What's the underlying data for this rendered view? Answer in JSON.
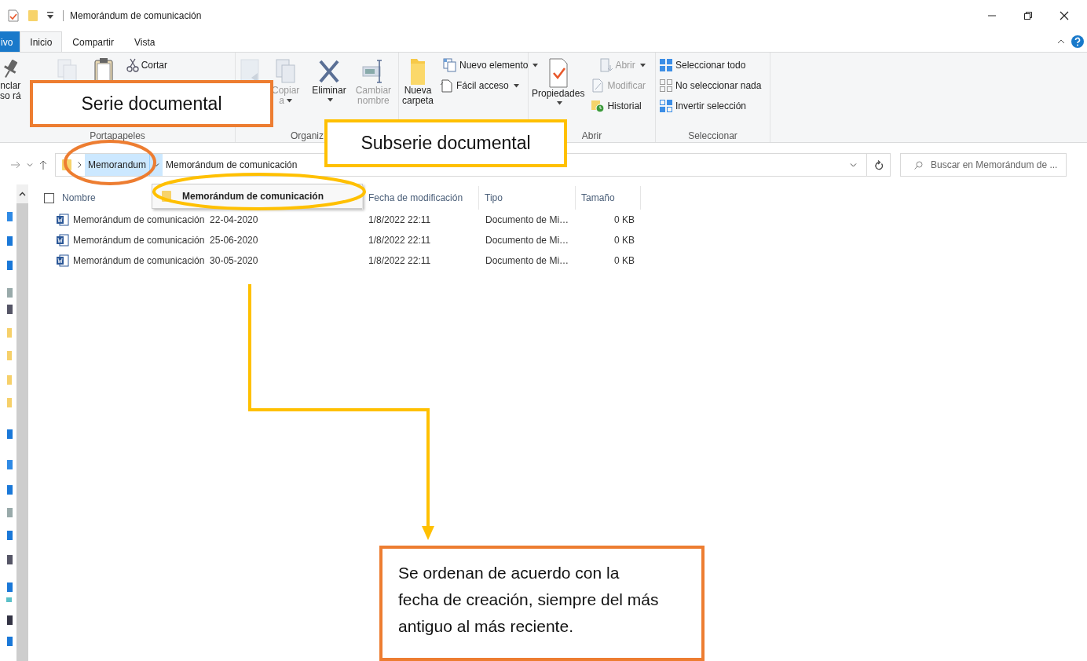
{
  "window": {
    "title": "Memorándum de comunicación"
  },
  "ribbon_tabs": [
    {
      "label": "ivo",
      "kind": "file",
      "selected": false
    },
    {
      "label": "Inicio",
      "kind": "tab",
      "selected": true
    },
    {
      "label": "Compartir",
      "kind": "tab",
      "selected": false
    },
    {
      "label": "Vista",
      "kind": "tab",
      "selected": false
    }
  ],
  "ribbon_groups": [
    {
      "label": "Portapapeles",
      "commands": [
        {
          "kind": "large",
          "lines": [
            "nclar",
            "so rá"
          ],
          "dropdown": false,
          "disabled": false
        },
        {
          "kind": "icon",
          "disabled": true
        },
        {
          "kind": "icon",
          "disabled": false
        },
        {
          "kind": "small",
          "label": "Cortar",
          "dropdown": false,
          "disabled": false
        }
      ]
    },
    {
      "label": "Organiz",
      "commands": [
        {
          "kind": "icon",
          "disabled": true
        },
        {
          "kind": "large",
          "lines": [
            "Copiar",
            "a"
          ],
          "dropdown": true,
          "disabled": true
        },
        {
          "kind": "large",
          "lines": [
            "Eliminar"
          ],
          "dropdown": true,
          "disabled": false
        },
        {
          "kind": "large",
          "lines": [
            "Cambiar",
            "nombre"
          ],
          "dropdown": false,
          "disabled": true
        }
      ]
    },
    {
      "commands": [
        {
          "kind": "large",
          "lines": [
            "Nueva",
            "carpeta"
          ],
          "dropdown": false,
          "disabled": false
        },
        {
          "kind": "small",
          "label": "Nuevo elemento",
          "dropdown": true,
          "disabled": false
        },
        {
          "kind": "small",
          "label": "Fácil acceso",
          "dropdown": true,
          "disabled": false
        }
      ]
    },
    {
      "label": "Abrir",
      "commands": [
        {
          "kind": "large",
          "lines": [
            "Propiedades"
          ],
          "dropdown": true,
          "disabled": false
        },
        {
          "kind": "small",
          "label": "Abrir",
          "dropdown": true,
          "disabled": true
        },
        {
          "kind": "small",
          "label": "Modificar",
          "dropdown": false,
          "disabled": true
        },
        {
          "kind": "small",
          "label": "Historial",
          "dropdown": false,
          "disabled": false
        }
      ]
    },
    {
      "label": "Seleccionar",
      "commands": [
        {
          "kind": "small",
          "label": "Seleccionar todo",
          "dropdown": false,
          "disabled": false
        },
        {
          "kind": "small",
          "label": "No seleccionar nada",
          "dropdown": false,
          "disabled": false
        },
        {
          "kind": "small",
          "label": "Invertir selección",
          "dropdown": false,
          "disabled": false
        }
      ]
    }
  ],
  "address": {
    "breadcrumbs": [
      {
        "label": "Memorandum",
        "selected": true
      },
      {
        "label": "Memorándum de comunicación",
        "selected": false
      }
    ],
    "menu": [
      {
        "label": "Memorándum de comunicación"
      }
    ],
    "search": {
      "placeholder": "Buscar en Memorándum de ..."
    }
  },
  "file_list": {
    "checked": false,
    "columns": [
      "Nombre",
      "Fecha de modificación",
      "Tipo",
      "Tamaño"
    ],
    "rows": [
      {
        "name": "Memorándum de comunicación  22-04-2020",
        "modified": "1/8/2022 22:11",
        "type": "Documento de Mi…",
        "size": "0 KB"
      },
      {
        "name": "Memorándum de comunicación  25-06-2020",
        "modified": "1/8/2022 22:11",
        "type": "Documento de Mi…",
        "size": "0 KB"
      },
      {
        "name": "Memorándum de comunicación  30-05-2020",
        "modified": "1/8/2022 22:11",
        "type": "Documento de Mi…",
        "size": "0 KB"
      }
    ]
  },
  "annotations": [
    {
      "kind": "ellipse",
      "color": "#ed7d31"
    },
    {
      "kind": "ellipse",
      "color": "#ffc000"
    },
    {
      "kind": "label",
      "text": "Serie documental",
      "color": "#ed7d31"
    },
    {
      "kind": "label",
      "text": "Subserie documental",
      "color": "#ffc000"
    },
    {
      "kind": "arrow",
      "color": "#ffc000"
    },
    {
      "kind": "note",
      "text": "Se ordenan de acuerdo con la fecha de creación, siempre del más antiguo al más reciente.",
      "color": "#ed7d31"
    }
  ]
}
